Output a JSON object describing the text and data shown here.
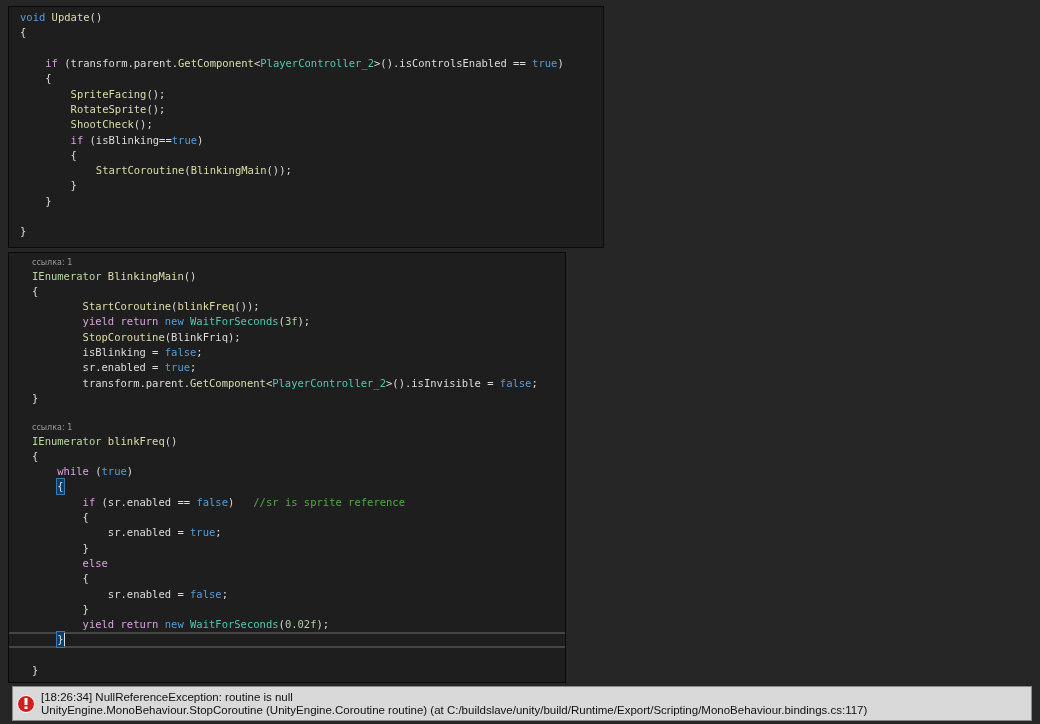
{
  "panels": [
    {
      "lines": [
        {
          "kind": "code",
          "current": false,
          "tokens": [
            {
              "kind": "kw",
              "text": "void"
            },
            {
              "kind": "fn",
              "text": " Update"
            },
            {
              "kind": "p",
              "text": "()"
            }
          ]
        },
        {
          "kind": "code",
          "current": false,
          "tokens": [
            {
              "kind": "p",
              "text": "{"
            }
          ],
          "children": [
            {
              "kind": "blank",
              "current": false
            },
            {
              "kind": "code",
              "current": false,
              "tokens": [
                {
                  "kind": "ctrl",
                  "text": "if"
                },
                {
                  "kind": "p",
                  "text": " (transform.parent."
                },
                {
                  "kind": "fn",
                  "text": "GetComponent"
                },
                {
                  "kind": "p",
                  "text": "<"
                },
                {
                  "kind": "type",
                  "text": "PlayerController_2"
                },
                {
                  "kind": "p",
                  "text": ">().isControlsEnabled == "
                },
                {
                  "kind": "kw",
                  "text": "true"
                },
                {
                  "kind": "p",
                  "text": ")"
                }
              ]
            },
            {
              "kind": "code",
              "current": false,
              "tokens": [
                {
                  "kind": "p",
                  "text": "{"
                }
              ],
              "children": [
                {
                  "kind": "code",
                  "current": false,
                  "tokens": [
                    {
                      "kind": "fn",
                      "text": "SpriteFacing"
                    },
                    {
                      "kind": "p",
                      "text": "();"
                    }
                  ]
                },
                {
                  "kind": "code",
                  "current": false,
                  "tokens": [
                    {
                      "kind": "fn",
                      "text": "RotateSprite"
                    },
                    {
                      "kind": "p",
                      "text": "();"
                    }
                  ]
                },
                {
                  "kind": "code",
                  "current": false,
                  "tokens": [
                    {
                      "kind": "fn",
                      "text": "ShootCheck"
                    },
                    {
                      "kind": "p",
                      "text": "();"
                    }
                  ]
                },
                {
                  "kind": "code",
                  "current": false,
                  "tokens": [
                    {
                      "kind": "ctrl",
                      "text": "if"
                    },
                    {
                      "kind": "p",
                      "text": " (isBlinking=="
                    },
                    {
                      "kind": "kw",
                      "text": "true"
                    },
                    {
                      "kind": "p",
                      "text": ")"
                    }
                  ]
                },
                {
                  "kind": "code",
                  "current": false,
                  "tokens": [
                    {
                      "kind": "p",
                      "text": "{"
                    }
                  ],
                  "children": [
                    {
                      "kind": "code",
                      "current": false,
                      "tokens": [
                        {
                          "kind": "fn",
                          "text": "StartCoroutine"
                        },
                        {
                          "kind": "p",
                          "text": "("
                        },
                        {
                          "kind": "fn",
                          "text": "BlinkingMain"
                        },
                        {
                          "kind": "p",
                          "text": "());"
                        }
                      ]
                    }
                  ]
                },
                {
                  "kind": "code",
                  "current": false,
                  "tokens": [
                    {
                      "kind": "p",
                      "text": "}"
                    }
                  ]
                }
              ]
            },
            {
              "kind": "code",
              "current": false,
              "tokens": [
                {
                  "kind": "p",
                  "text": "}"
                }
              ]
            },
            {
              "kind": "blank",
              "current": false
            }
          ]
        },
        {
          "kind": "code",
          "current": false,
          "tokens": [
            {
              "kind": "p",
              "text": "}"
            }
          ]
        }
      ]
    },
    {
      "lines": [
        {
          "kind": "lens",
          "text": "ссылка: 1",
          "current": false
        },
        {
          "kind": "code",
          "current": false,
          "tokens": [
            {
              "kind": "iface",
              "text": "IEnumerator"
            },
            {
              "kind": "fn",
              "text": " BlinkingMain"
            },
            {
              "kind": "p",
              "text": "()"
            }
          ]
        },
        {
          "kind": "code",
          "current": false,
          "tokens": [
            {
              "kind": "p",
              "text": "{"
            }
          ],
          "children": [
            {
              "kind": "group",
              "children": [
                {
                  "kind": "code",
                  "current": false,
                  "tokens": [
                    {
                      "kind": "fn",
                      "text": "StartCoroutine"
                    },
                    {
                      "kind": "p",
                      "text": "("
                    },
                    {
                      "kind": "fn",
                      "text": "blinkFreq"
                    },
                    {
                      "kind": "p",
                      "text": "());"
                    }
                  ]
                },
                {
                  "kind": "code",
                  "current": false,
                  "tokens": [
                    {
                      "kind": "ctrl",
                      "text": "yield return"
                    },
                    {
                      "kind": "kw",
                      "text": " new"
                    },
                    {
                      "kind": "type",
                      "text": " WaitForSeconds"
                    },
                    {
                      "kind": "p",
                      "text": "("
                    },
                    {
                      "kind": "num",
                      "text": "3f"
                    },
                    {
                      "kind": "p",
                      "text": ");"
                    }
                  ]
                },
                {
                  "kind": "code",
                  "current": false,
                  "tokens": [
                    {
                      "kind": "fn",
                      "text": "StopCoroutine"
                    },
                    {
                      "kind": "p",
                      "text": "(BlinkFriq);"
                    }
                  ]
                },
                {
                  "kind": "code",
                  "current": false,
                  "tokens": [
                    {
                      "kind": "p",
                      "text": "isBlinking = "
                    },
                    {
                      "kind": "kw",
                      "text": "false"
                    },
                    {
                      "kind": "p",
                      "text": ";"
                    }
                  ]
                },
                {
                  "kind": "code",
                  "current": false,
                  "tokens": [
                    {
                      "kind": "p",
                      "text": "sr.enabled = "
                    },
                    {
                      "kind": "kw",
                      "text": "true"
                    },
                    {
                      "kind": "p",
                      "text": ";"
                    }
                  ]
                },
                {
                  "kind": "code",
                  "current": false,
                  "tokens": [
                    {
                      "kind": "p",
                      "text": "transform.parent."
                    },
                    {
                      "kind": "fn",
                      "text": "GetComponent"
                    },
                    {
                      "kind": "p",
                      "text": "<"
                    },
                    {
                      "kind": "type",
                      "text": "PlayerController_2"
                    },
                    {
                      "kind": "p",
                      "text": ">().isInvisible = "
                    },
                    {
                      "kind": "kw",
                      "text": "false"
                    },
                    {
                      "kind": "p",
                      "text": ";"
                    }
                  ]
                }
              ]
            }
          ]
        },
        {
          "kind": "code",
          "current": false,
          "tokens": [
            {
              "kind": "p",
              "text": "}"
            }
          ]
        },
        {
          "kind": "blank",
          "current": false
        },
        {
          "kind": "lens",
          "text": "ссылка: 1",
          "current": false
        },
        {
          "kind": "code",
          "current": false,
          "tokens": [
            {
              "kind": "iface",
              "text": "IEnumerator"
            },
            {
              "kind": "fn",
              "text": " blinkFreq"
            },
            {
              "kind": "p",
              "text": "()"
            }
          ]
        },
        {
          "kind": "code",
          "current": false,
          "tokens": [
            {
              "kind": "p",
              "text": "{"
            }
          ],
          "children": [
            {
              "kind": "code",
              "current": false,
              "tokens": [
                {
                  "kind": "ctrl",
                  "text": "while"
                },
                {
                  "kind": "p",
                  "text": " ("
                },
                {
                  "kind": "kw",
                  "text": "true"
                },
                {
                  "kind": "p",
                  "text": ")"
                }
              ]
            },
            {
              "kind": "code",
              "current": false,
              "tokens": [
                {
                  "kind": "match",
                  "text": "{"
                }
              ],
              "children": [
                {
                  "kind": "code",
                  "current": false,
                  "tokens": [
                    {
                      "kind": "ctrl",
                      "text": "if"
                    },
                    {
                      "kind": "p",
                      "text": " (sr.enabled == "
                    },
                    {
                      "kind": "kw",
                      "text": "false"
                    },
                    {
                      "kind": "p",
                      "text": ")   "
                    },
                    {
                      "kind": "cmt",
                      "text": "//sr is sprite reference"
                    }
                  ]
                },
                {
                  "kind": "code",
                  "current": false,
                  "tokens": [
                    {
                      "kind": "p",
                      "text": "{"
                    }
                  ],
                  "children": [
                    {
                      "kind": "code",
                      "current": false,
                      "tokens": [
                        {
                          "kind": "p",
                          "text": "sr.enabled = "
                        },
                        {
                          "kind": "kw",
                          "text": "true"
                        },
                        {
                          "kind": "p",
                          "text": ";"
                        }
                      ]
                    }
                  ]
                },
                {
                  "kind": "code",
                  "current": false,
                  "tokens": [
                    {
                      "kind": "p",
                      "text": "}"
                    }
                  ]
                },
                {
                  "kind": "code",
                  "current": false,
                  "tokens": [
                    {
                      "kind": "ctrl",
                      "text": "else"
                    }
                  ]
                },
                {
                  "kind": "code",
                  "current": false,
                  "tokens": [
                    {
                      "kind": "p",
                      "text": "{"
                    }
                  ],
                  "children": [
                    {
                      "kind": "code",
                      "current": false,
                      "tokens": [
                        {
                          "kind": "p",
                          "text": "sr.enabled = "
                        },
                        {
                          "kind": "kw",
                          "text": "false"
                        },
                        {
                          "kind": "p",
                          "text": ";"
                        }
                      ]
                    }
                  ]
                },
                {
                  "kind": "code",
                  "current": false,
                  "tokens": [
                    {
                      "kind": "p",
                      "text": "}"
                    }
                  ]
                },
                {
                  "kind": "code",
                  "current": false,
                  "tokens": [
                    {
                      "kind": "ctrl",
                      "text": "yield return"
                    },
                    {
                      "kind": "kw",
                      "text": " new"
                    },
                    {
                      "kind": "type",
                      "text": " WaitForSeconds"
                    },
                    {
                      "kind": "p",
                      "text": "("
                    },
                    {
                      "kind": "num",
                      "text": "0.02f"
                    },
                    {
                      "kind": "p",
                      "text": ");"
                    }
                  ]
                }
              ]
            },
            {
              "kind": "code",
              "current": true,
              "tokens": [
                {
                  "kind": "match",
                  "text": "}"
                }
              ]
            },
            {
              "kind": "blank",
              "current": false
            }
          ]
        },
        {
          "kind": "code",
          "current": false,
          "tokens": [
            {
              "kind": "p",
              "text": "}"
            }
          ]
        }
      ]
    }
  ],
  "console": {
    "kind": "error",
    "message": "[18:26:34] NullReferenceException: routine is null",
    "trace": "UnityEngine.MonoBehaviour.StopCoroutine (UnityEngine.Coroutine routine) (at C:/buildslave/unity/build/Runtime/Export/Scripting/MonoBehaviour.bindings.cs:117)"
  }
}
